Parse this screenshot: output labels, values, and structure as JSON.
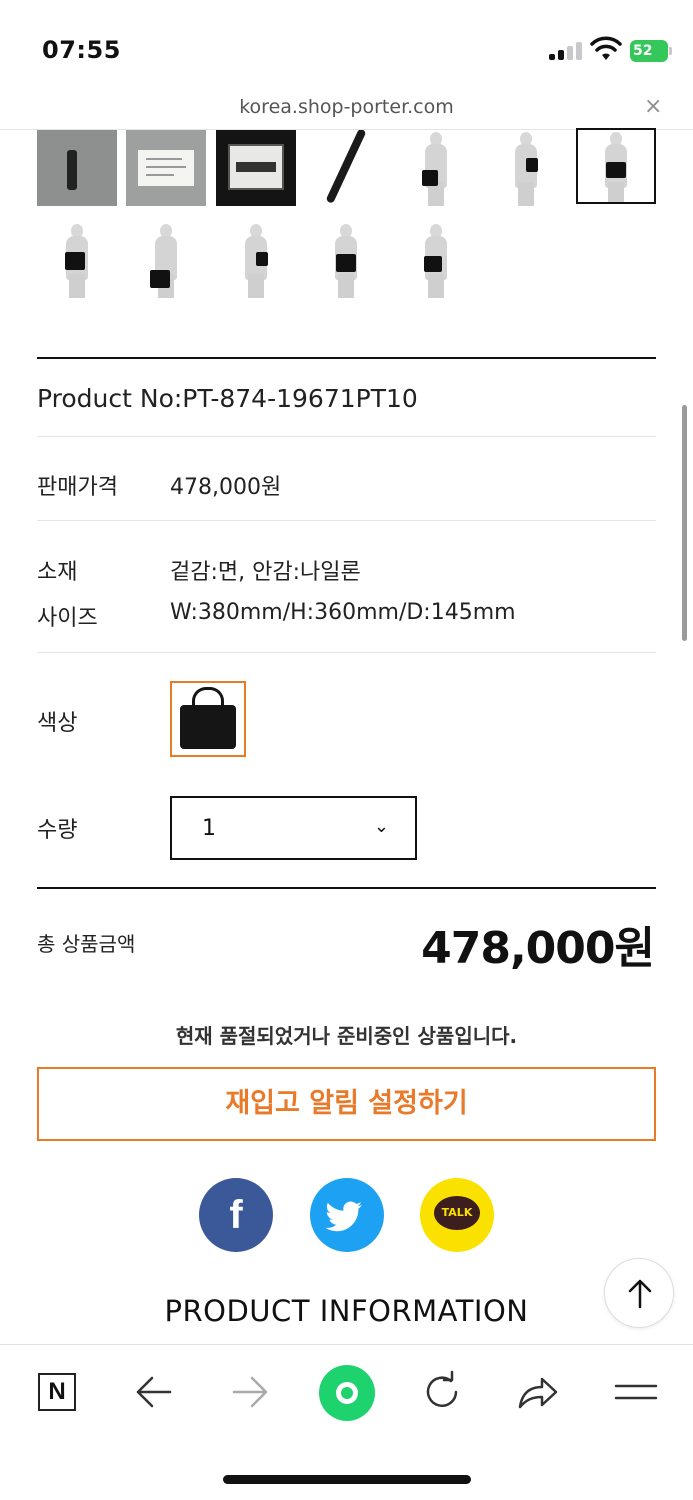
{
  "status_bar": {
    "time": "07:55",
    "battery_level": "52",
    "icons": [
      "signal-icon",
      "wifi-icon",
      "battery-icon"
    ]
  },
  "browser": {
    "url": "korea.shop-porter.com",
    "close_icon": "×"
  },
  "product": {
    "number_label": "Product No:PT-874-19671PT10",
    "specs": [
      {
        "label": "판매가격",
        "value": "478,000원"
      },
      {
        "label": "소재",
        "value": "겉감:면, 안감:나일론"
      },
      {
        "label": "사이즈",
        "value": "W:380mm/H:360mm/D:145mm"
      }
    ],
    "color_label": "색상",
    "quantity_label": "수량",
    "quantity_value": "1",
    "total_label": "총 상품금액",
    "total_value": "478,000원",
    "soldout_message": "현재 품절되었거나 준비중인 상품입니다.",
    "restock_button": "재입고 알림 설정하기"
  },
  "share": {
    "facebook_glyph": "f",
    "kakao_text": "TALK"
  },
  "section_title": "PRODUCT INFORMATION",
  "toolbar": {
    "naver_glyph": "N"
  },
  "colors": {
    "accent": "#e87a2a",
    "facebook": "#3b5998",
    "twitter": "#1da1f2",
    "kakao": "#fae100",
    "home": "#1ed36e"
  }
}
